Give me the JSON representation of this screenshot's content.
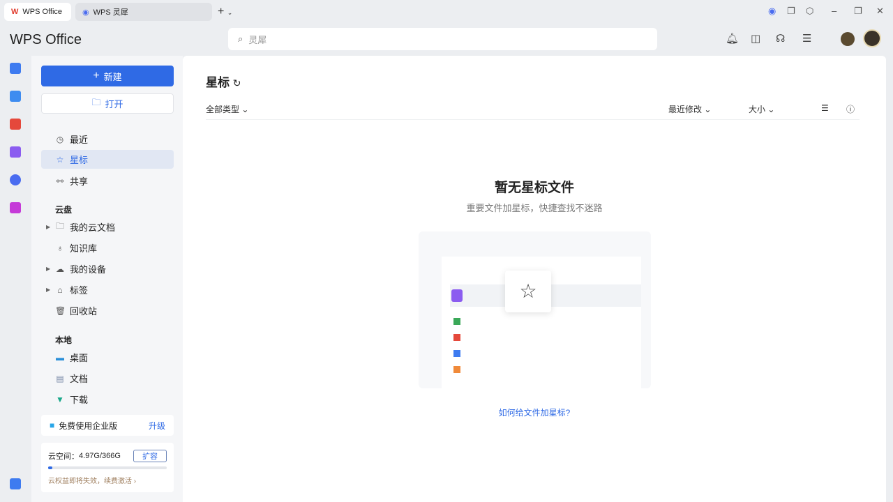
{
  "tabs": [
    {
      "label": "WPS Office"
    },
    {
      "label": "WPS 灵犀"
    }
  ],
  "header": {
    "brand": "WPS Office",
    "search_placeholder": "灵犀"
  },
  "sidebar": {
    "new_label": "新建",
    "open_label": "打开",
    "nav": [
      {
        "label": "最近"
      },
      {
        "label": "星标"
      },
      {
        "label": "共享"
      }
    ],
    "cloud_title": "云盘",
    "cloud": [
      {
        "label": "我的云文档"
      },
      {
        "label": "知识库"
      },
      {
        "label": "我的设备"
      },
      {
        "label": "标签"
      },
      {
        "label": "回收站"
      }
    ],
    "local_title": "本地",
    "local": [
      {
        "label": "桌面"
      },
      {
        "label": "文档"
      },
      {
        "label": "下载"
      }
    ],
    "enterprise": {
      "label": "免费使用企业版",
      "action": "升级"
    },
    "storage": {
      "label": "云空间：",
      "value": "4.97G/366G",
      "expand": "扩容",
      "percent": 1.4,
      "notice": "云权益即将失效，续费激活"
    }
  },
  "main": {
    "title": "星标",
    "type_filter": "全部类型",
    "sort_modified": "最近修改",
    "sort_size": "大小",
    "empty_title": "暂无星标文件",
    "empty_subtitle": "重要文件加星标，快捷查找不迷路",
    "help_link": "如何给文件加星标?"
  },
  "colors": {
    "accent": "#2f6ae5"
  }
}
